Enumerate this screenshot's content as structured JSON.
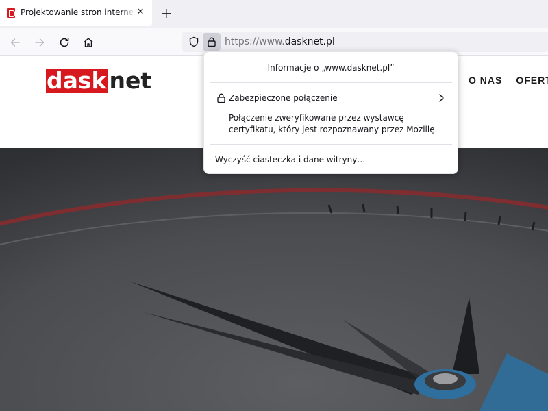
{
  "tab": {
    "title": "Projektowanie stron internetowych",
    "close_glyph": "✕",
    "new_tab_glyph": "+",
    "favicon": "dasknet-favicon",
    "favicon_color": "#d7191f"
  },
  "toolbar": {
    "back_icon": "arrow-left-icon",
    "forward_icon": "arrow-right-icon",
    "reload_icon": "reload-icon",
    "home_icon": "home-icon"
  },
  "urlbar": {
    "scheme": "https://www.",
    "host": "dasknet.pl",
    "shield_icon": "tracking-shield-icon",
    "lock_icon": "padlock-icon"
  },
  "site": {
    "logo_part1": "dask",
    "logo_part2": "net",
    "brand_color": "#d7191f",
    "menu": [
      "O NAS",
      "OFERTA"
    ]
  },
  "popup": {
    "title": "Informacje o „www.dasknet.pl”",
    "secure_label": "Zabezpieczone połączenie",
    "verify_text": "Połączenie zweryfikowane przez wystawcę certyfikatu, który jest rozpoznawany przez Mozillę.",
    "clear_label": "Wyczyść ciasteczka i dane witryny…"
  }
}
